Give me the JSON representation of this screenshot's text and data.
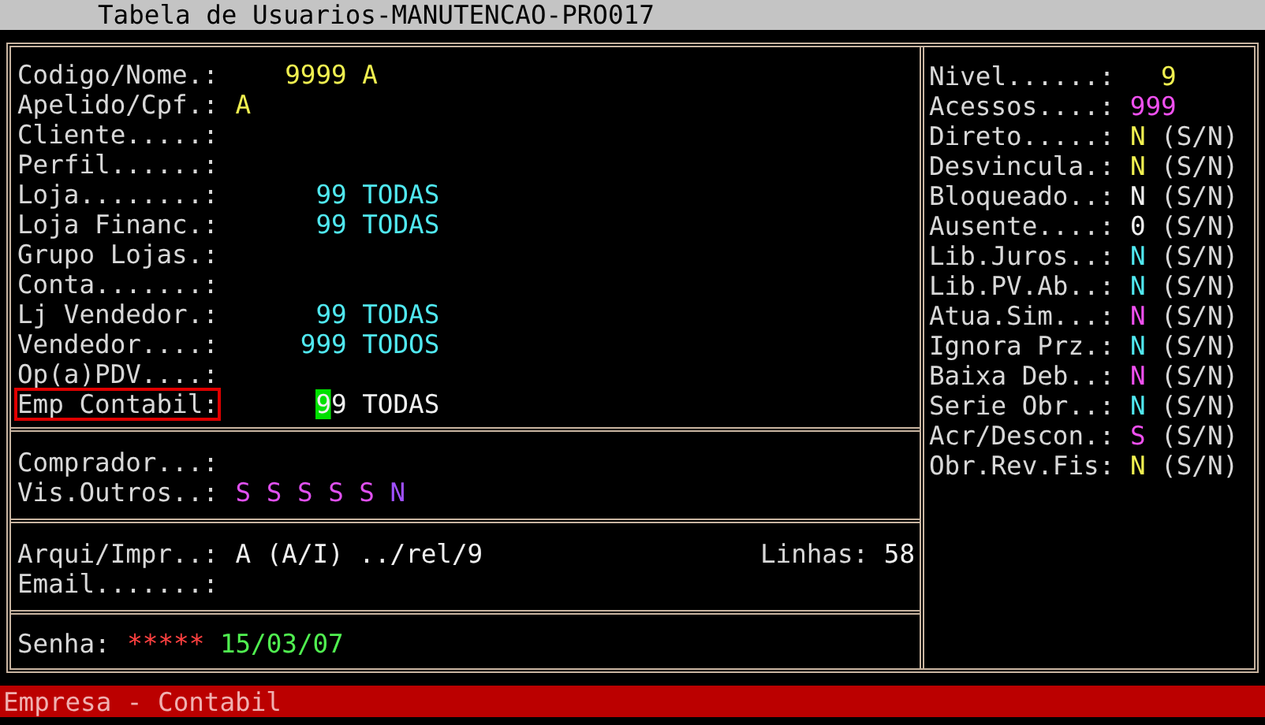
{
  "window": {
    "title": "Tabela de Usuarios-MANUTENCAO-PRO017"
  },
  "left": {
    "sections": [
      {
        "rows": [
          {
            "kind": "coded",
            "label": "Codigo/Nome.:",
            "code": "9999",
            "desc": "A",
            "color": "#f0f050",
            "focused": false
          },
          {
            "kind": "text",
            "label": "Apelido/Cpf.:",
            "value": "A",
            "color": "#f0f050",
            "focused": false
          },
          {
            "kind": "text",
            "label": "Cliente.....:",
            "focused": false
          },
          {
            "kind": "text",
            "label": "Perfil......:",
            "focused": false
          },
          {
            "kind": "coded",
            "label": "Loja........:",
            "code": "99",
            "desc": "TODAS",
            "color": "#50e8f0",
            "focused": false
          },
          {
            "kind": "coded",
            "label": "Loja Financ.:",
            "code": "99",
            "desc": "TODAS",
            "color": "#50e8f0",
            "focused": false
          },
          {
            "kind": "text",
            "label": "Grupo Lojas.:",
            "focused": false
          },
          {
            "kind": "text",
            "label": "Conta.......:",
            "focused": false
          },
          {
            "kind": "coded",
            "label": "Lj Vendedor.:",
            "code": "99",
            "desc": "TODAS",
            "color": "#50e8f0",
            "focused": false
          },
          {
            "kind": "coded",
            "label": "Vendedor....:",
            "code": "999",
            "desc": "TODOS",
            "color": "#50e8f0",
            "focused": false
          },
          {
            "kind": "text",
            "label": "Op(a)PDV....:",
            "focused": false
          },
          {
            "kind": "coded",
            "label": "Emp Contabil:",
            "code": "99",
            "desc": "TODAS",
            "color": "#f0f0f0",
            "focused": true
          }
        ]
      },
      {
        "rows": [
          {
            "kind": "text",
            "label": "Comprador...:",
            "focused": false
          },
          {
            "kind": "flags",
            "label": "Vis.Outros..:",
            "focused": false,
            "flags": [
              {
                "text": "S",
                "color": "#e050f0"
              },
              {
                "text": "S",
                "color": "#e050f0"
              },
              {
                "text": "S",
                "color": "#e050f0"
              },
              {
                "text": "S",
                "color": "#e050f0"
              },
              {
                "text": "S",
                "color": "#e050f0"
              },
              {
                "text": "N",
                "color": "#a050ff"
              }
            ]
          }
        ]
      },
      {
        "rows": [
          {
            "kind": "output",
            "label": "Arqui/Impr..:",
            "value": "A",
            "hint": "(A/I)",
            "path": "../rel/9",
            "lines_label": "Linhas:",
            "lines": "58",
            "color": "#f0f0f0",
            "focused": false
          },
          {
            "kind": "text",
            "label": "Email.......:",
            "focused": false
          }
        ]
      },
      {
        "rows": [
          {
            "kind": "password",
            "label": "Senha:",
            "mask": "*****",
            "date": "15/03/07",
            "focused": false
          }
        ]
      }
    ]
  },
  "right": {
    "rows": [
      {
        "kind": "number",
        "label": "Nivel......:",
        "value": "9",
        "color": "#f0f050"
      },
      {
        "kind": "number",
        "label": "Acessos....:",
        "value": "999",
        "color": "#f050f0"
      },
      {
        "kind": "flag",
        "label": "Direto.....:",
        "value": "N",
        "hint": "(S/N)",
        "color": "#f0f050"
      },
      {
        "kind": "flag",
        "label": "Desvincula.:",
        "value": "N",
        "hint": "(S/N)",
        "color": "#f0f050"
      },
      {
        "kind": "flag",
        "label": "Bloqueado..:",
        "value": "N",
        "hint": "(S/N)",
        "color": "#f0f0f0"
      },
      {
        "kind": "flag",
        "label": "Ausente....:",
        "value": "0",
        "hint": "(S/N)",
        "color": "#f0f0f0"
      },
      {
        "kind": "flag",
        "label": "Lib.Juros..:",
        "value": "N",
        "hint": "(S/N)",
        "color": "#50e8f0"
      },
      {
        "kind": "flag",
        "label": "Lib.PV.Ab..:",
        "value": "N",
        "hint": "(S/N)",
        "color": "#50e8f0"
      },
      {
        "kind": "flag",
        "label": "Atua.Sim...:",
        "value": "N",
        "hint": "(S/N)",
        "color": "#f050f0"
      },
      {
        "kind": "flag",
        "label": "Ignora Prz.:",
        "value": "N",
        "hint": "(S/N)",
        "color": "#50e8f0"
      },
      {
        "kind": "flag",
        "label": "Baixa Deb..:",
        "value": "N",
        "hint": "(S/N)",
        "color": "#f050f0"
      },
      {
        "kind": "flag",
        "label": "Serie Obr..:",
        "value": "N",
        "hint": "(S/N)",
        "color": "#50e8f0"
      },
      {
        "kind": "flag",
        "label": "Acr/Descon.:",
        "value": "S",
        "hint": "(S/N)",
        "color": "#f050f0"
      },
      {
        "kind": "flag",
        "label": "Obr.Rev.Fis:",
        "value": "N",
        "hint": "(S/N)",
        "color": "#f0f050"
      }
    ]
  },
  "status_bar": {
    "text": "Empresa - Contabil"
  }
}
